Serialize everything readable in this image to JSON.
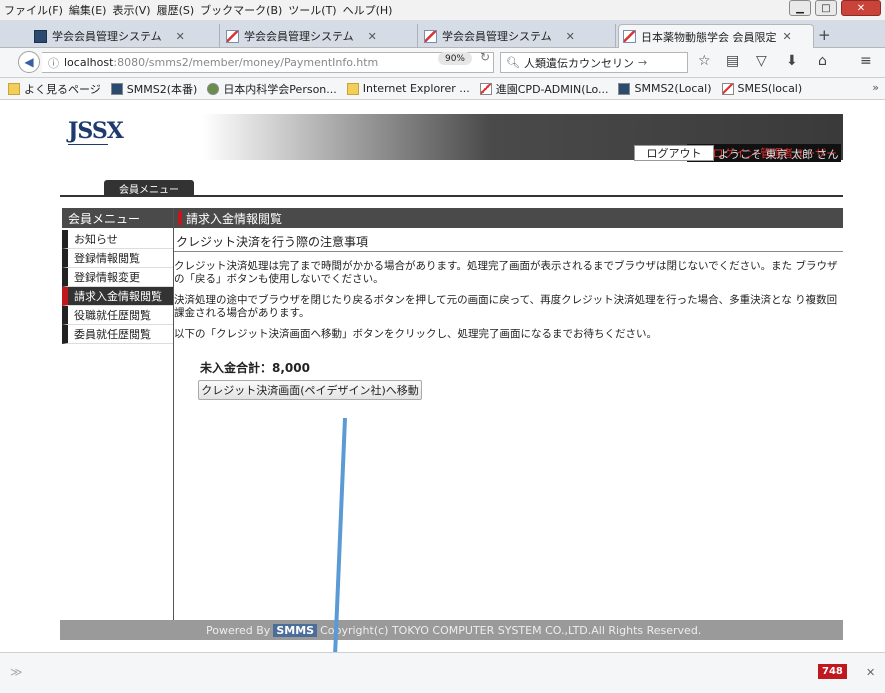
{
  "menubar": {
    "items": [
      "ファイル(F)",
      "編集(E)",
      "表示(V)",
      "履歴(S)",
      "ブックマーク(B)",
      "ツール(T)",
      "ヘルプ(H)"
    ]
  },
  "tabs": [
    {
      "label": "学会会員管理システム",
      "icon": "app-icon"
    },
    {
      "label": "学会会員管理システム",
      "icon": "image-icon"
    },
    {
      "label": "学会会員管理システム",
      "icon": "image-icon"
    },
    {
      "label": "日本薬物動態学会 会員限定",
      "icon": "image-icon",
      "active": true
    }
  ],
  "nav": {
    "url_host": "localhost",
    "url_path": ":8080/smms2/member/money/PaymentInfo.htm",
    "zoom": "90%",
    "search": "人類遺伝カウンセリン"
  },
  "bookmarks": [
    {
      "label": "よく見るページ",
      "icon": "folder"
    },
    {
      "label": "SMMS2(本番)",
      "icon": "dark"
    },
    {
      "label": "日本内科学会Person...",
      "icon": "globe"
    },
    {
      "label": "Internet Explorer ...",
      "icon": "folder"
    },
    {
      "label": "進園CPD-ADMIN(Lo...",
      "icon": "img"
    },
    {
      "label": "SMMS2(Local)",
      "icon": "dark"
    },
    {
      "label": "SMES(local)",
      "icon": "img"
    }
  ],
  "header": {
    "logo": "JSSX",
    "proxy_login": "代理ログイン:管理者ユーザー",
    "logout": "ログアウト",
    "welcome": "ようこそ 東京 太郎 さん",
    "menu_tab": "会員メニュー"
  },
  "sidebar": {
    "title": "会員メニュー",
    "items": [
      "お知らせ",
      "登録情報閲覧",
      "登録情報変更",
      "請求入金情報閲覧",
      "役職就任歴閲覧",
      "委員就任歴閲覧"
    ],
    "active_index": 3
  },
  "main": {
    "title": "請求入金情報閲覧",
    "section": "クレジット決済を行う際の注意事項",
    "para1": "クレジット決済処理は完了まで時間がかかる場合があります。処理完了画面が表示されるまでブラウザは閉じないでください。また ブラウザの「戻る」ボタンも使用しないでください。",
    "para2": "決済処理の途中でブラウザを閉じたり戻るボタンを押して元の画面に戻って、再度クレジット決済処理を行った場合、多重決済とな り複数回課金される場合があります。",
    "para3": "以下の「クレジット決済画面へ移動」ボタンをクリックし、処理完了画面になるまでお待ちください。",
    "total": "未入金合計：8,000",
    "pay_button": "クレジット決済画面(ペイデザイン社)へ移動"
  },
  "footer": {
    "powered": "Powered By",
    "smms": "SMMS",
    "copyright": "Copyright(c) TOKYO COMPUTER SYSTEM CO.,LTD.All Rights Reserved."
  },
  "statusbar": {
    "badge": "748"
  }
}
